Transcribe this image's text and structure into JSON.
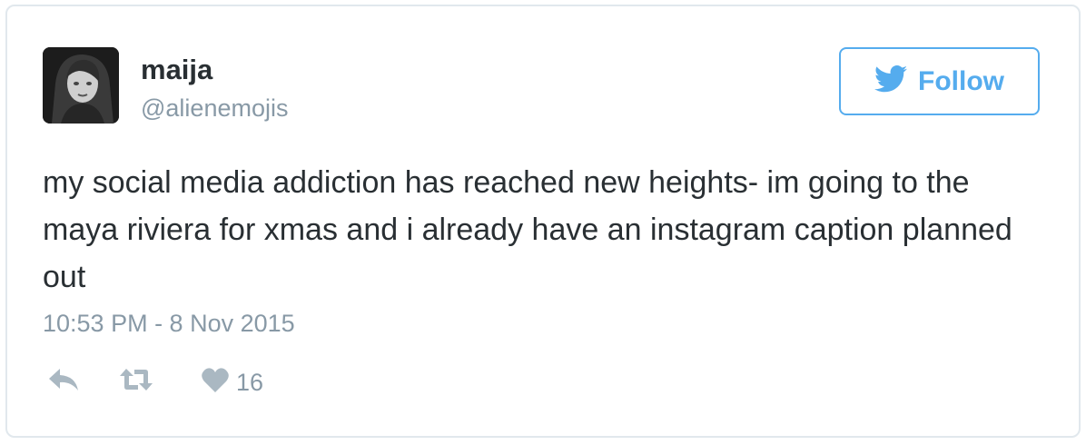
{
  "user": {
    "display_name": "maija",
    "handle": "@alienemojis"
  },
  "follow_button": {
    "label": "Follow"
  },
  "tweet": {
    "text": "my social media addiction has reached new heights- im going to the maya riviera for xmas and i already have an instagram caption planned out",
    "timestamp": "10:53 PM - 8 Nov 2015"
  },
  "actions": {
    "reply_icon": "reply-icon",
    "retweet_icon": "retweet-icon",
    "like_icon": "heart-icon",
    "like_count": "16"
  },
  "colors": {
    "brand": "#55acee",
    "text": "#292f33",
    "muted": "#8899a6",
    "icon": "#aab8c2",
    "border": "#e1e8ed"
  }
}
